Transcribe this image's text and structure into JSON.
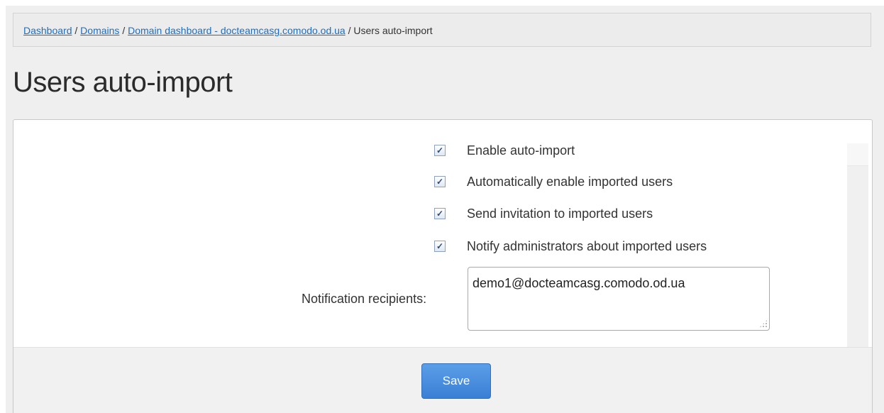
{
  "breadcrumb": {
    "items": [
      "Dashboard",
      "Domains",
      "Domain dashboard - docteamcasg.comodo.od.ua"
    ],
    "separator": "/",
    "current": "Users auto-import"
  },
  "page": {
    "title": "Users auto-import"
  },
  "options": [
    {
      "label": "Enable auto-import",
      "checked": true
    },
    {
      "label": "Automatically enable imported users",
      "checked": true
    },
    {
      "label": "Send invitation to imported users",
      "checked": true
    },
    {
      "label": "Notify administrators about imported users",
      "checked": true
    }
  ],
  "recipients": {
    "label": "Notification recipients:",
    "value": "demo1@docteamcasg.comodo.od.ua"
  },
  "footer": {
    "save_label": "Save"
  },
  "colors": {
    "link": "#1a6fc2",
    "primary_button": "#3a7fd5",
    "background": "#efefef"
  }
}
